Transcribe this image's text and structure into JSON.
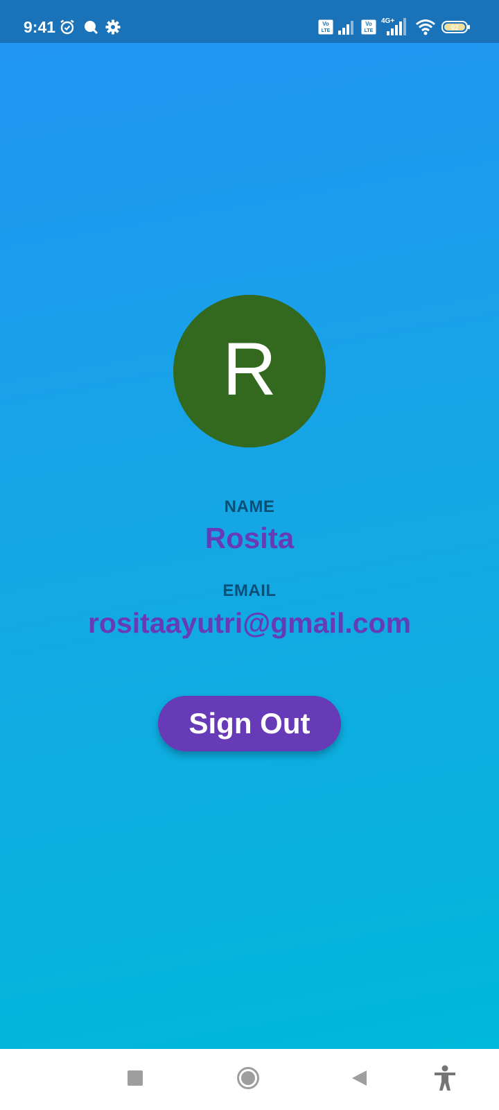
{
  "status_bar": {
    "time": "9:41",
    "icons": [
      "alarm-icon",
      "search-icon",
      "settings-icon",
      "volte-icon",
      "signal-icon",
      "volte-icon",
      "signal-4g-icon",
      "wifi-icon",
      "battery-icon"
    ],
    "network_label": "4G+",
    "volte_label": "Vo LTE",
    "battery_level": "92"
  },
  "profile": {
    "avatar_initial": "R",
    "avatar_color": "#33691e",
    "name_label": "NAME",
    "name_value": "Rosita",
    "email_label": "EMAIL",
    "email_value": "rositaayutri@gmail.com",
    "signout_label": "Sign Out",
    "accent_color": "#673ab7"
  },
  "nav_bar": {
    "buttons": [
      "recents-square-icon",
      "home-circle-icon",
      "back-triangle-icon",
      "accessibility-icon"
    ]
  }
}
